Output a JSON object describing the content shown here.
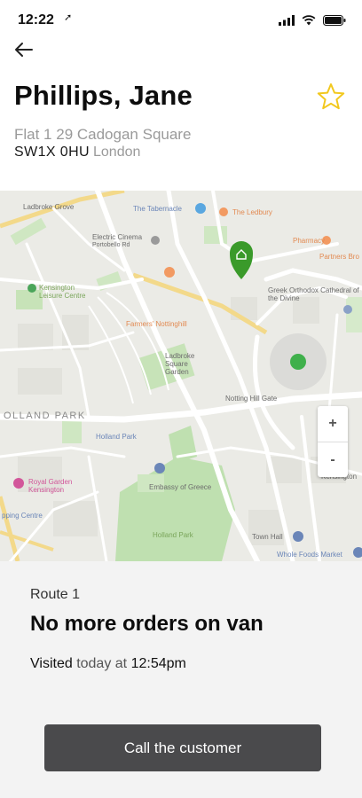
{
  "status_bar": {
    "time": "12:22",
    "location_arrow": "➚"
  },
  "header": {
    "back_icon": "arrow-left-icon",
    "title": "Phillips, Jane",
    "favorite_icon": "star-outline-icon"
  },
  "address": {
    "line1": "Flat 1 29 Cadogan Square",
    "postcode": "SW1X 0HU",
    "city": "London"
  },
  "map": {
    "labels": {
      "ladbroke_grove": "Ladbroke Grove",
      "tabernacle": "The Tabernacle",
      "ledbury": "The Ledbury",
      "electric_cinema": "Electric Cinema",
      "portobello": "Portobello Rd",
      "pharmacy": "Pharmacy",
      "partners": "Partners Bro",
      "kensington_leisure": "Kensington Leisure Centre",
      "greek_orthodox": "Greek Orthodox Cathedral of the Divine",
      "farmers_market": "Farmers' Nottinghill",
      "ladbroke_square": "Ladbroke Square Garden",
      "notting_hill_gate": "Notting Hill Gate",
      "holland_park_area": "OLLAND PARK",
      "holland_park_station": "Holland Park",
      "embassy_greece": "Embassy of Greece",
      "holland_park_green": "Holland Park",
      "royal_garden": "Royal Garden Kensington",
      "town_hall": "Town Hall",
      "whole_foods": "Whole Foods Market",
      "kensington": "Kensington",
      "shopping_centre": "pping Centre"
    },
    "zoom_in": "+",
    "zoom_out": "-"
  },
  "details": {
    "route": "Route 1",
    "status": "No more orders on van",
    "visited_prefix": "Visited",
    "visited_when": "today at",
    "visited_time": "12:54pm"
  },
  "actions": {
    "call_label": "Call the customer"
  },
  "colors": {
    "accent_green": "#3a9a2a",
    "star_yellow": "#f2c81e",
    "button_dark": "#4a4a4c"
  }
}
